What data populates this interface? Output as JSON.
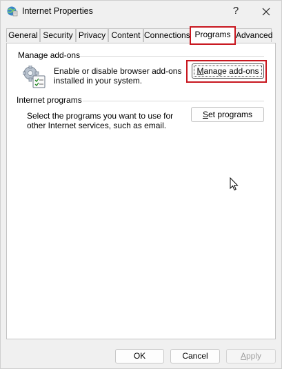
{
  "window": {
    "title": "Internet Properties",
    "help_glyph": "?"
  },
  "tabs": [
    {
      "label": "General"
    },
    {
      "label": "Security"
    },
    {
      "label": "Privacy"
    },
    {
      "label": "Content"
    },
    {
      "label": "Connections"
    },
    {
      "label": "Programs",
      "active": true
    },
    {
      "label": "Advanced"
    }
  ],
  "manage_addons": {
    "header": "Manage add-ons",
    "description_line1": "Enable or disable browser add-ons",
    "description_line2": "installed in your system.",
    "button_label_mnemonic": "M",
    "button_label_rest": "anage add-ons"
  },
  "internet_programs": {
    "header": "Internet programs",
    "description_line1": "Select the programs you want to use for",
    "description_line2": "other Internet services, such as email.",
    "button_label_mnemonic": "S",
    "button_label_rest": "et programs"
  },
  "footer": {
    "ok_label": "OK",
    "cancel_label": "Cancel",
    "apply_label_mnemonic": "A",
    "apply_label_rest": "pply"
  },
  "colors": {
    "highlight": "#c8161e",
    "panel_bg": "#ffffff",
    "window_bg": "#f0f0f0"
  }
}
